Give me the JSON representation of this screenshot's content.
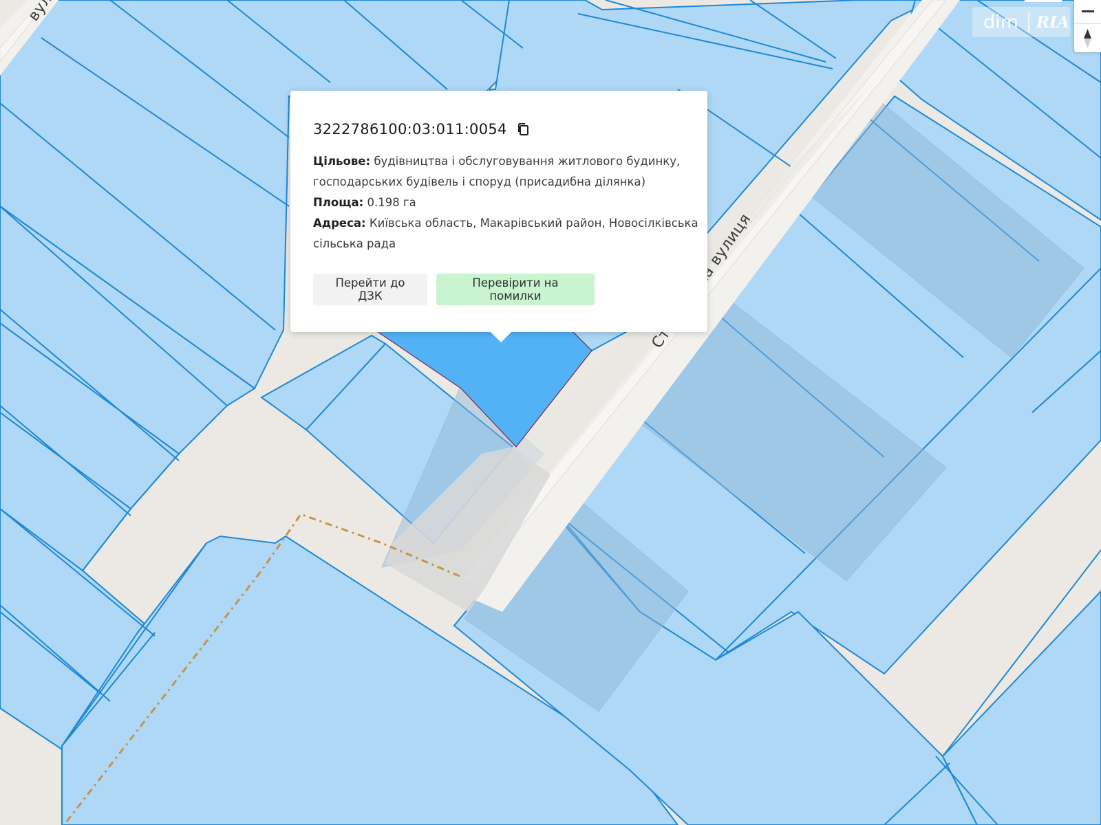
{
  "parcel": {
    "cadastral_number": "3222786100:03:011:0054",
    "purpose_label": "Цільове:",
    "purpose_value": "будівництва і обслуговування житлового будинку, господарських будівель і споруд (присадибна ділянка)",
    "area_label": "Площа:",
    "area_value": "0.198 га",
    "address_label": "Адреса:",
    "address_value": "Київська область, Макарівський район, Новосілківська сільська рада"
  },
  "buttons": {
    "goto_dzk": "Перейти до ДЗК",
    "check_errors": "Перевірити на помилки"
  },
  "map": {
    "street_label_main": "Столярська вулиця",
    "street_label_top": "вули",
    "parcel_color": "#aed8f5",
    "selected_parcel_color": "#52b2f5",
    "road_color": "#ece9e4"
  },
  "branding": {
    "logo_dim": "dim",
    "logo_ria": "RIA"
  },
  "controls": {
    "zoom_out_icon": "minus-icon",
    "compass_icon": "compass-icon"
  }
}
